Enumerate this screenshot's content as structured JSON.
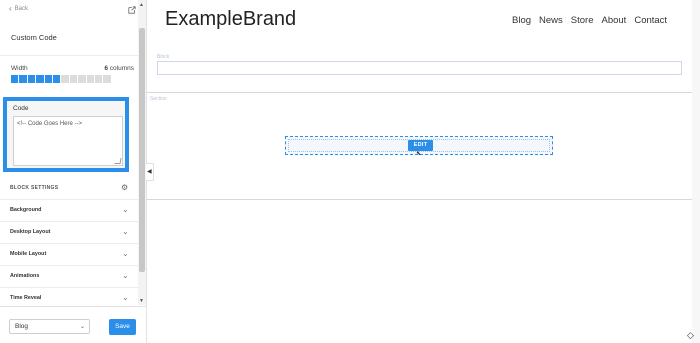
{
  "panel": {
    "back_label": "Back",
    "title": "Custom Code",
    "width_label": "Width",
    "width_count": "6",
    "width_unit": "columns",
    "columns_total": 12,
    "columns_active": 6,
    "code_label": "Code",
    "code_value": "<!-- Code Goes Here -->",
    "block_settings_label": "BLOCK SETTINGS",
    "accordion": [
      "Background",
      "Desktop Layout",
      "Mobile Layout",
      "Animations",
      "Time Reveal"
    ],
    "page_select_value": "Blog",
    "save_label": "Save"
  },
  "site": {
    "brand": "ExampleBrand",
    "nav": [
      "Blog",
      "News",
      "Store",
      "About",
      "Contact"
    ]
  },
  "canvas": {
    "block_label": "Block",
    "section_label": "Section",
    "edit_label": "EDIT"
  },
  "colors": {
    "accent": "#2b8ee8"
  }
}
